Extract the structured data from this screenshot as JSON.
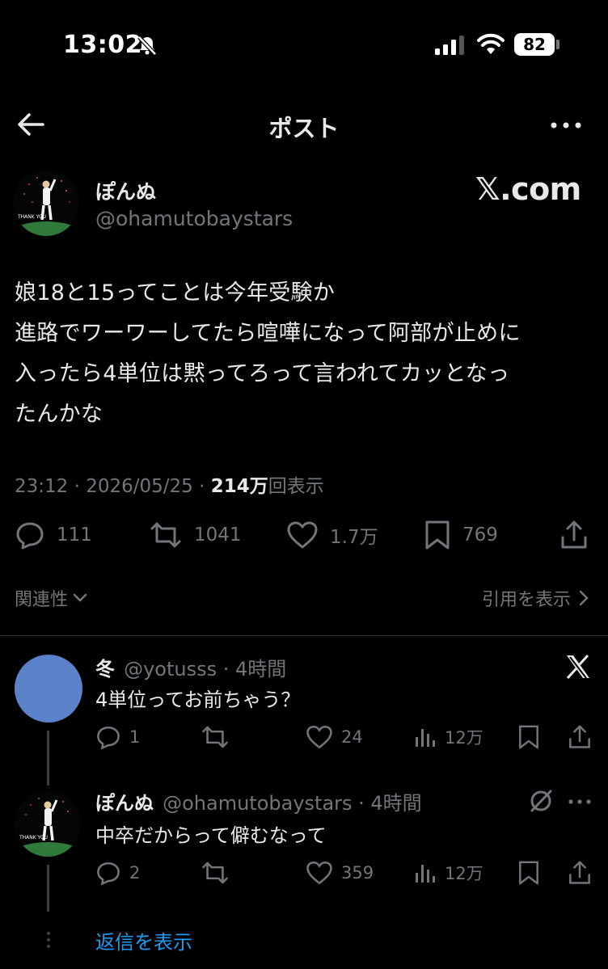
{
  "status_bar": {
    "time": "13:02",
    "battery": "82"
  },
  "header": {
    "title": "ポスト"
  },
  "post": {
    "author_name": "ぽんぬ",
    "author_handle": "@ohamutobaystars",
    "watermark": "𝕏.com",
    "avatar_caption": "THANK YOU",
    "body": "娘18と15ってことは今年受験か\n進路でワーワーしてたら喧嘩になって阿部が止めに\n入ったら4単位は黙ってろって言われてカッとなっ\nたんかな",
    "timestamp": "23:12 · 2026/05/25 · ",
    "views_count": "214万",
    "views_label": "回表示",
    "replies": "111",
    "reposts": "1041",
    "likes": "1.7万",
    "bookmarks": "769"
  },
  "links": {
    "related": "関連性",
    "view_quotes": "引用を表示"
  },
  "replies": [
    {
      "name": "冬",
      "handle": "@yotusss",
      "time": " · 4時間",
      "text": "4単位ってお前ちゃう？",
      "replies": "1",
      "reposts": "",
      "likes": "24",
      "views": "12万",
      "avatar_color": "#5b82c9"
    },
    {
      "name": "ぽんぬ",
      "handle": "@ohamutobaystars",
      "time": " · 4時間",
      "text": "中卒だからって僻むなって",
      "replies": "2",
      "reposts": "",
      "likes": "359",
      "views": "12万"
    }
  ],
  "show_replies": "返信を表示"
}
